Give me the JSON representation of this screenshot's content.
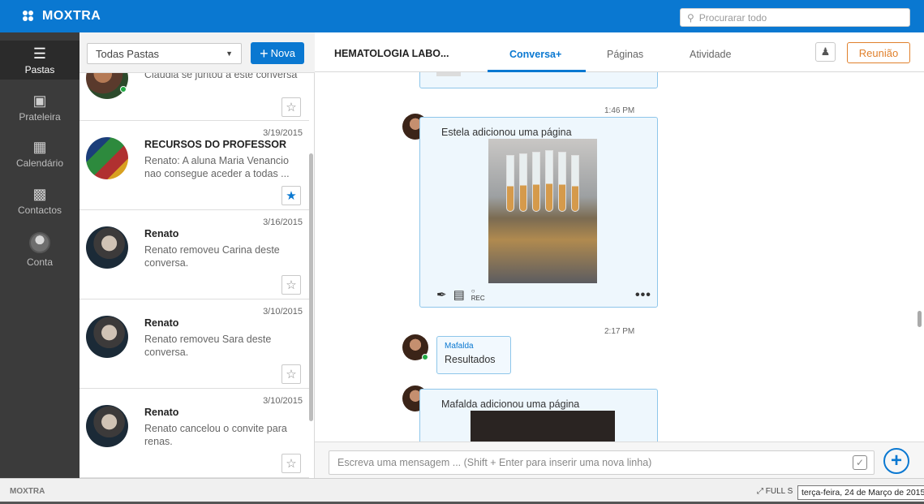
{
  "app": {
    "brand": "MOXTRA",
    "footer_brand": "MOXTRA"
  },
  "search": {
    "placeholder": "Procurarar todo"
  },
  "nav": [
    {
      "label": "Pastas",
      "icon": "list-icon",
      "active": true
    },
    {
      "label": "Prateleira",
      "icon": "shelf-icon",
      "active": false
    },
    {
      "label": "Calendário",
      "icon": "calendar-icon",
      "active": false
    },
    {
      "label": "Contactos",
      "icon": "contacts-icon",
      "active": false
    },
    {
      "label": "Conta",
      "icon": "avatar-icon",
      "active": false
    }
  ],
  "list": {
    "folder_select": "Todas Pastas",
    "new_button": "Nova",
    "items": [
      {
        "date": "",
        "name": "",
        "message": "Claudia se juntou a este conversa",
        "starred": false
      },
      {
        "date": "3/19/2015",
        "name": "RECURSOS DO PROFESSOR",
        "message": "Renato: A aluna Maria Venancio nao consegue aceder a todas ...",
        "starred": true
      },
      {
        "date": "3/16/2015",
        "name": "Renato",
        "message": "Renato removeu Carina deste conversa.",
        "starred": false
      },
      {
        "date": "3/10/2015",
        "name": "Renato",
        "message": "Renato removeu Sara deste conversa.",
        "starred": false
      },
      {
        "date": "3/10/2015",
        "name": "Renato",
        "message": "Renato cancelou o convite para renas.",
        "starred": false
      }
    ]
  },
  "binder": {
    "title": "HEMATOLOGIA LABO...",
    "tabs": [
      "Conversa+",
      "Páginas",
      "Atividade"
    ],
    "meeting_button": "Reunião"
  },
  "feed": {
    "entry1": {
      "time": "1:46 PM",
      "text": "Estela adicionou uma página",
      "rec_label": "REC",
      "more": "•••"
    },
    "entry2": {
      "time": "2:17 PM",
      "author": "Mafalda",
      "text": "Resultados"
    },
    "entry3": {
      "text": "Mafalda adicionou uma página"
    }
  },
  "composer": {
    "placeholder": "Escreva uma mensagem ... (Shift + Enter para inserir uma nova linha)"
  },
  "footer": {
    "fullscreen": "FULL S",
    "tooltip": "terça-feira, 24 de Março de 2015"
  },
  "colors": {
    "brand": "#0a78d1",
    "meeting": "#e0802c",
    "nav_bg": "#3b3b3b",
    "card_border": "#8ec6ea",
    "online": "#22aa44"
  }
}
